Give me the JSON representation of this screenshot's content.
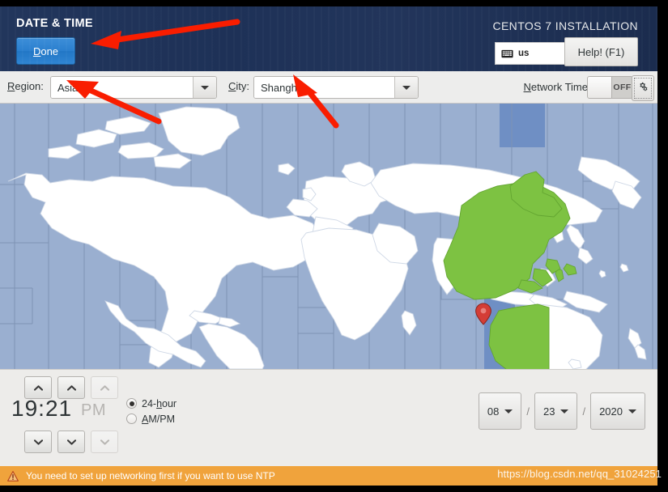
{
  "header": {
    "title": "DATE & TIME",
    "done_label": "Done",
    "done_mnemonic": "D",
    "done_rest": "one",
    "install_label": "CENTOS 7 INSTALLATION",
    "keyboard_layout": "us",
    "keyboard_icon": "keyboard-icon",
    "help_label": "Help! (F1)"
  },
  "toolbar": {
    "region_label_mnemonic": "R",
    "region_label_rest": "egion:",
    "region_value": "Asia",
    "city_label_mnemonic": "C",
    "city_label_rest": "ity:",
    "city_value": "Shanghai",
    "network_time_mnemonic": "N",
    "network_time_rest": "etwork Time",
    "network_time_state": "OFF",
    "config_icon": "gear-icon"
  },
  "map": {
    "selected_city_marker": "location-pin-icon",
    "highlight_color": "#7dc242",
    "ocean_color": "#9aafd0",
    "land_color": "#ffffff",
    "band_color": "#6f8fc4"
  },
  "time": {
    "hour": "19",
    "separator": ":",
    "minute": "21",
    "ampm_indicator": "PM",
    "format_24h_mnemonic_pre": "24-",
    "format_24h_mnemonic": "h",
    "format_24h_rest": "our",
    "format_24h_selected": true,
    "format_ampm_mnemonic": "A",
    "format_ampm_rest": "M/PM",
    "format_ampm_selected": false,
    "up_icon": "chevron-up-icon",
    "down_icon": "chevron-down-icon"
  },
  "date": {
    "month": "08",
    "day": "23",
    "year": "2020",
    "separator": "/",
    "dropdown_icon": "chevron-down-icon"
  },
  "status": {
    "warning_icon": "warning-triangle-icon",
    "warning_text": "You need to set up networking first if you want to use NTP",
    "watermark": "https://blog.csdn.net/qq_31024251"
  },
  "annotations": {
    "arrow_color": "#f91d00",
    "arrow_done": "arrow-pointing-to-done-button",
    "arrow_region": "arrow-pointing-to-region-field",
    "arrow_city": "arrow-pointing-to-city-field"
  }
}
